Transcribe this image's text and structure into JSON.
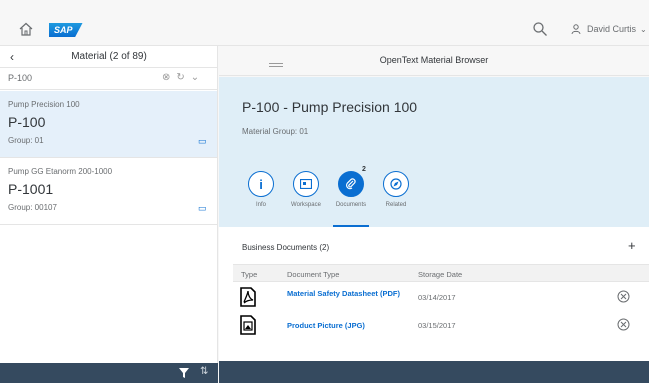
{
  "shell": {
    "logo": "SAP",
    "user_name": "David Curtis"
  },
  "master": {
    "title": "Material (2 of 89)",
    "search_value": "P-100",
    "items": [
      {
        "description": "Pump Precision 100",
        "number": "P-100",
        "group": "Group: 01"
      },
      {
        "description": "Pump GG Etanorm 200-1000",
        "number": "P-1001",
        "group": "Group: 00107"
      }
    ]
  },
  "detail": {
    "app_title": "OpenText Material Browser",
    "object_title": "P-100 - Pump Precision 100",
    "object_subtitle": "Material Group: 01",
    "tabs": [
      {
        "label": "Info",
        "icon": "info-icon"
      },
      {
        "label": "Workspace",
        "icon": "workspace-icon"
      },
      {
        "label": "Documents",
        "icon": "paperclip-icon",
        "badge": "2",
        "active": true
      },
      {
        "label": "Related",
        "icon": "related-icon"
      }
    ],
    "documents": {
      "header": "Business Documents (2)",
      "add_label": "+",
      "columns": [
        "Type",
        "Document Type",
        "Storage Date"
      ],
      "rows": [
        {
          "type_icon": "pdf-document-icon",
          "name": "Material Safety Datasheet (PDF)",
          "date": "03/14/2017"
        },
        {
          "type_icon": "image-document-icon",
          "name": "Product Picture (JPG)",
          "date": "03/15/2017"
        }
      ]
    }
  },
  "colors": {
    "accent": "#0a6ed1",
    "header_bg": "#dfeef7",
    "footer_bar": "#354a5f"
  }
}
